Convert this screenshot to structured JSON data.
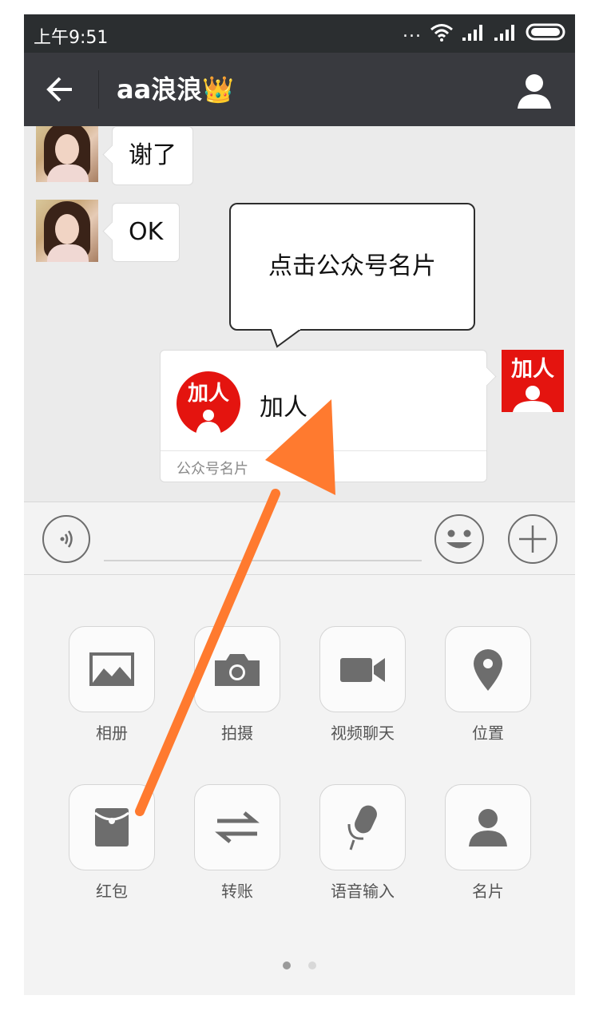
{
  "status_bar": {
    "time": "上午9:51",
    "more_dots": "..."
  },
  "header": {
    "title": "aa浪浪",
    "title_emoji": "👑"
  },
  "messages": [
    {
      "side": "left",
      "text": "谢了"
    },
    {
      "side": "left",
      "text": "OK"
    }
  ],
  "tooltip": {
    "text": "点击公众号名片"
  },
  "card": {
    "logo_text": "加人",
    "name": "加人",
    "type_label": "公众号名片"
  },
  "my_avatar": {
    "logo_text": "加人"
  },
  "input": {
    "value": "",
    "placeholder": ""
  },
  "tools": [
    {
      "label": "相册",
      "icon": "image-icon"
    },
    {
      "label": "拍摄",
      "icon": "camera-icon"
    },
    {
      "label": "视频聊天",
      "icon": "video-camera-icon"
    },
    {
      "label": "位置",
      "icon": "location-pin-icon"
    },
    {
      "label": "红包",
      "icon": "red-envelope-icon"
    },
    {
      "label": "转账",
      "icon": "transfer-arrows-icon"
    },
    {
      "label": "语音输入",
      "icon": "microphone-icon"
    },
    {
      "label": "名片",
      "icon": "person-card-icon"
    }
  ],
  "pager": {
    "pages": 2,
    "current": 1
  },
  "colors": {
    "header_bg": "#393a3f",
    "status_bg": "#2b2e30",
    "chat_bg": "#ebebeb",
    "panel_bg": "#f3f3f3",
    "icon_gray": "#6d6d6d",
    "brand_red": "#e4140f",
    "annotation_arrow": "#ff7a2f"
  }
}
